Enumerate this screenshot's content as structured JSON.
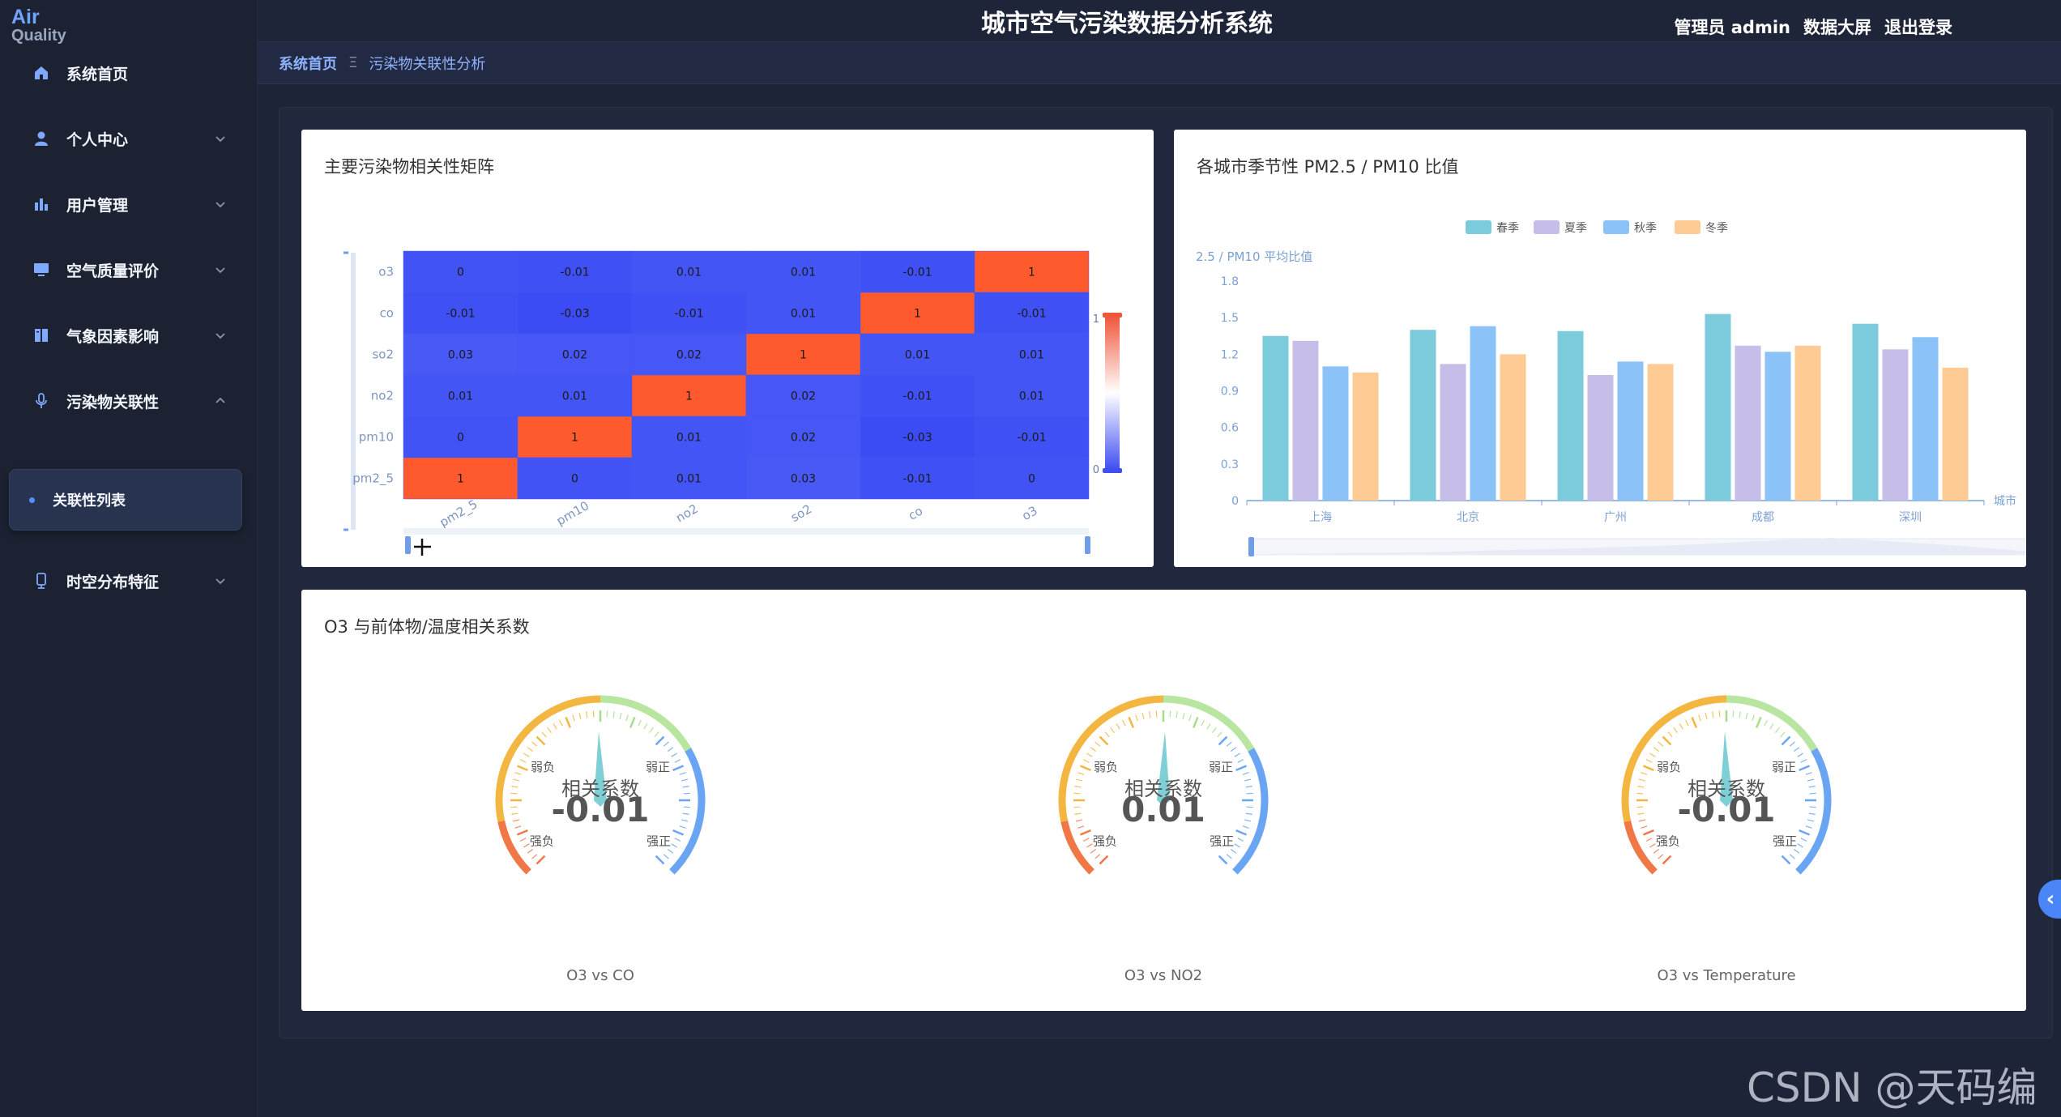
{
  "logo": {
    "line1": "Air",
    "line2": "Quality"
  },
  "header": {
    "title": "城市空气污染数据分析系统",
    "user": "管理员 admin",
    "dashboard": "数据大屏",
    "logout": "退出登录"
  },
  "breadcrumb": {
    "home": "系统首页",
    "separator": "Ξ",
    "current": "污染物关联性分析"
  },
  "sidebar": {
    "items": [
      {
        "label": "系统首页",
        "icon": "home-icon"
      },
      {
        "label": "个人中心",
        "icon": "user-icon"
      },
      {
        "label": "用户管理",
        "icon": "bar-chart-icon"
      },
      {
        "label": "空气质量评价",
        "icon": "monitor-icon"
      },
      {
        "label": "气象因素影响",
        "icon": "book-icon"
      },
      {
        "label": "污染物关联性",
        "icon": "mic-icon"
      },
      {
        "label": "关联性列表",
        "icon": "dot-icon"
      },
      {
        "label": "时空分布特征",
        "icon": "device-icon"
      }
    ]
  },
  "colors": {
    "accent": "#5b8cff",
    "heat_low": "#3b4cf5",
    "heat_high": "#ff5a2d",
    "teal": "#7ccbdc",
    "lavender": "#c6bde9",
    "sky": "#8bc2f8",
    "peach": "#fecb94"
  },
  "heatmap_card": {
    "title": "主要污染物相关性矩阵",
    "chart_data": {
      "type": "heatmap",
      "x": [
        "pm2_5",
        "pm10",
        "no2",
        "so2",
        "co",
        "o3"
      ],
      "y": [
        "pm2_5",
        "pm10",
        "no2",
        "so2",
        "co",
        "o3"
      ],
      "values": [
        [
          1,
          0,
          0.01,
          0.03,
          -0.01,
          0
        ],
        [
          0,
          1,
          0.01,
          0.02,
          -0.03,
          -0.01
        ],
        [
          0.01,
          0.01,
          1,
          0.02,
          -0.01,
          0.01
        ],
        [
          0.03,
          0.02,
          0.02,
          1,
          0.01,
          0.01
        ],
        [
          -0.01,
          -0.03,
          -0.01,
          0.01,
          1,
          -0.01
        ],
        [
          0,
          -0.01,
          0.01,
          0.01,
          -0.01,
          1
        ]
      ],
      "scale_labels": [
        "1",
        "0"
      ]
    }
  },
  "bar_card": {
    "title": "各城市季节性 PM2.5 / PM10 比值",
    "chart_data": {
      "type": "bar",
      "categories": [
        "上海",
        "北京",
        "广州",
        "成都",
        "深圳"
      ],
      "series": [
        {
          "name": "春季",
          "values": [
            1.35,
            1.4,
            1.39,
            1.53,
            1.45
          ]
        },
        {
          "name": "夏季",
          "values": [
            1.31,
            1.12,
            1.03,
            1.27,
            1.24
          ]
        },
        {
          "name": "秋季",
          "values": [
            1.1,
            1.43,
            1.14,
            1.22,
            1.34
          ]
        },
        {
          "name": "冬季",
          "values": [
            1.05,
            1.2,
            1.12,
            1.27,
            1.09
          ]
        }
      ],
      "ylabel": "2.5 / PM10 平均比值",
      "xlabel": "城市",
      "yticks": [
        "0",
        "0.3",
        "0.6",
        "0.9",
        "1.2",
        "1.5",
        "1.8"
      ],
      "ylim": [
        0,
        1.8
      ]
    }
  },
  "gauge_card": {
    "title": "O3 与前体物/温度相关系数",
    "center_label": "相关系数",
    "tick_labels": {
      "weak_neg": "弱负",
      "weak_pos": "弱正",
      "strong_neg": "强负",
      "strong_pos": "强正"
    },
    "chart_data": {
      "type": "gauge",
      "range": [
        -1,
        1
      ],
      "gauges": [
        {
          "name": "O3 vs CO",
          "value": -0.01
        },
        {
          "name": "O3 vs NO2",
          "value": 0.01
        },
        {
          "name": "O3 vs Temperature",
          "value": -0.01
        }
      ]
    }
  },
  "side_toggle": "‹",
  "watermark": "CSDN @天码编程"
}
